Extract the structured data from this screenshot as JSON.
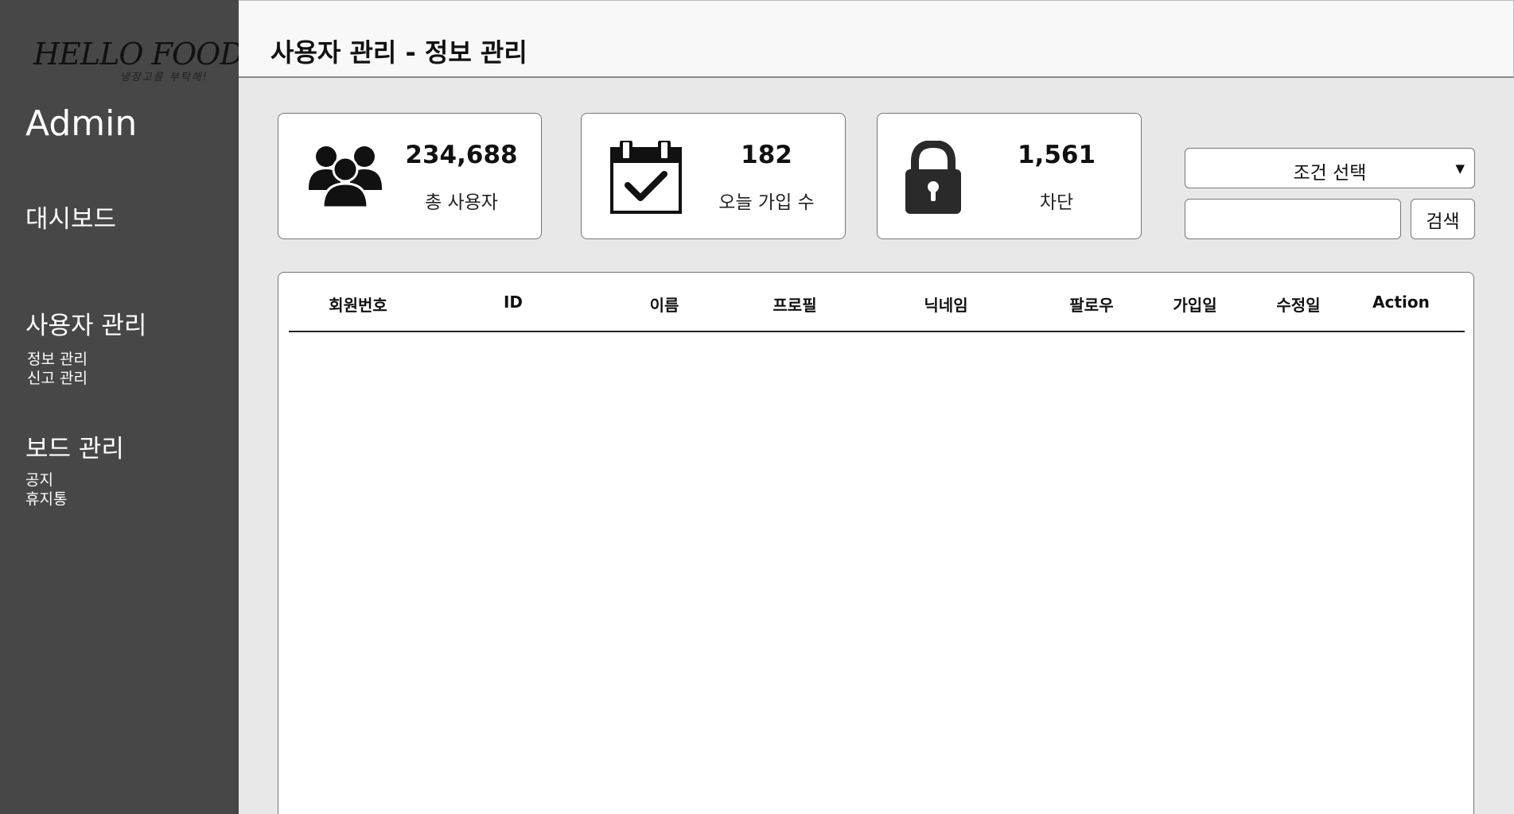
{
  "sidebar": {
    "logo_title": "HELLO FOOD",
    "logo_subtitle": "냉장고를 부탁해!",
    "admin_title": "Admin",
    "dashboard": "대시보드",
    "user_section": {
      "title": "사용자 관리",
      "items": [
        "정보 관리",
        "신고 관리"
      ]
    },
    "board_section": {
      "title": "보드 관리",
      "items": [
        "공지",
        "휴지통"
      ]
    }
  },
  "header": {
    "title": "사용자 관리 - 정보 관리"
  },
  "stats": [
    {
      "icon": "users-icon",
      "value": "234,688",
      "label": "총 사용자"
    },
    {
      "icon": "calendar-check-icon",
      "value": "182",
      "label": "오늘 가입 수"
    },
    {
      "icon": "lock-icon",
      "value": "1,561",
      "label": "차단"
    }
  ],
  "search": {
    "select_label": "조건 선택",
    "input_value": "",
    "button_label": "검색"
  },
  "table": {
    "columns": [
      "회원번호",
      "ID",
      "이름",
      "프로필",
      "닉네임",
      "팔로우",
      "가입일",
      "수정일",
      "Action"
    ],
    "rows": []
  },
  "colors": {
    "sidebar_bg": "#474747",
    "content_bg": "#e8e8e8",
    "header_bg": "#f8f8f8"
  }
}
